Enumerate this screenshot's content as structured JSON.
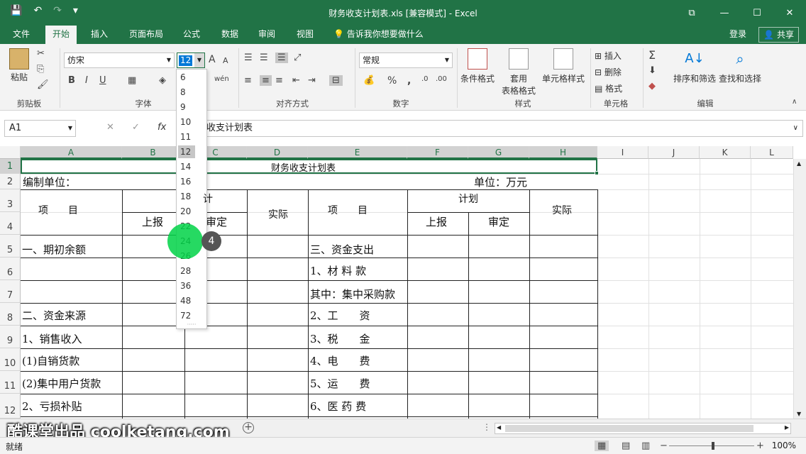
{
  "title_bar": {
    "title": "财务收支计划表.xls  [兼容模式] - Excel",
    "save_icon": "💾",
    "undo_icon": "↶",
    "redo_icon": "↷",
    "qat_more": "▾",
    "ribbon_display_icon": "⧉",
    "minimize": "—",
    "maximize": "☐",
    "close": "✕"
  },
  "tabs": [
    {
      "label": "文件"
    },
    {
      "label": "开始"
    },
    {
      "label": "插入"
    },
    {
      "label": "页面布局"
    },
    {
      "label": "公式"
    },
    {
      "label": "数据"
    },
    {
      "label": "审阅"
    },
    {
      "label": "视图"
    }
  ],
  "tell_me": "告诉我你想要做什么",
  "login": "登录",
  "share": "共享",
  "ribbon": {
    "groups": {
      "clipboard": "剪贴板",
      "font": "字体",
      "alignment": "对齐方式",
      "number": "数字",
      "styles": "样式",
      "cells": "单元格",
      "editing": "编辑"
    },
    "paste": "粘贴",
    "font_name": "仿宋",
    "font_size": "12",
    "bold": "B",
    "italic": "I",
    "underline": "U",
    "grow_font": "A",
    "shrink_font": "A",
    "phonetic": "wén",
    "number_format": "常规",
    "percent": "%",
    "comma": ",",
    "currency": "💰",
    "conditional_format": "条件格式",
    "format_as_table_1": "套用",
    "format_as_table_2": "表格格式",
    "cell_styles": "单元格样式",
    "insert": "插入",
    "delete": "删除",
    "format": "格式",
    "sort_filter": "排序和筛选",
    "find_select": "查找和选择"
  },
  "formula_bar": {
    "name_box": "A1",
    "cancel": "✕",
    "enter": "✓",
    "fx": "fx",
    "content": "收支计划表"
  },
  "columns": [
    "A",
    "B",
    "C",
    "D",
    "E",
    "F",
    "G",
    "H",
    "I",
    "J",
    "K",
    "L"
  ],
  "rows": [
    "1",
    "2",
    "3",
    "4",
    "5",
    "6",
    "7",
    "8",
    "9",
    "10",
    "11",
    "12"
  ],
  "cells": {
    "title": "财务收支计划表",
    "compiler": "编制单位：",
    "unit": "单位：万元",
    "item_left": "项　　目",
    "plan_left_partial": "计",
    "actual_left": "实际",
    "item_right": "项　　目",
    "plan_right": "计划",
    "actual_right": "实际",
    "report_left": "上报",
    "approve_left": "审定",
    "report_right": "上报",
    "approve_right": "审定",
    "r5a": "一、期初余额",
    "r5e": "三、资金支出",
    "r6e": "1、材 料 款",
    "r7e": "其中：集中采购款",
    "r8a": "二、资金来源",
    "r8e": "2、工　　资",
    "r9a": "1、销售收入",
    "r9e": "3、税　　金",
    "r10a": "(1)自销货款",
    "r10e": "4、电　　费",
    "r11a": "(2)集中用户货款",
    "r11e": "5、运　　费",
    "r12a": "2、亏损补贴",
    "r12e": "6、医 药 费"
  },
  "font_size_dropdown": {
    "options": [
      "6",
      "8",
      "9",
      "10",
      "11",
      "12",
      "14",
      "16",
      "18",
      "20",
      "22",
      "24",
      "26",
      "28",
      "36",
      "48",
      "72"
    ],
    "selected": "12",
    "grip": "·····"
  },
  "step_badge": "4",
  "watermark": "酷课堂出品 coolketang.com",
  "add_sheet": "+",
  "status": {
    "ready": "就绪",
    "zoom_out": "−",
    "zoom_in": "+",
    "zoom": "100%"
  }
}
